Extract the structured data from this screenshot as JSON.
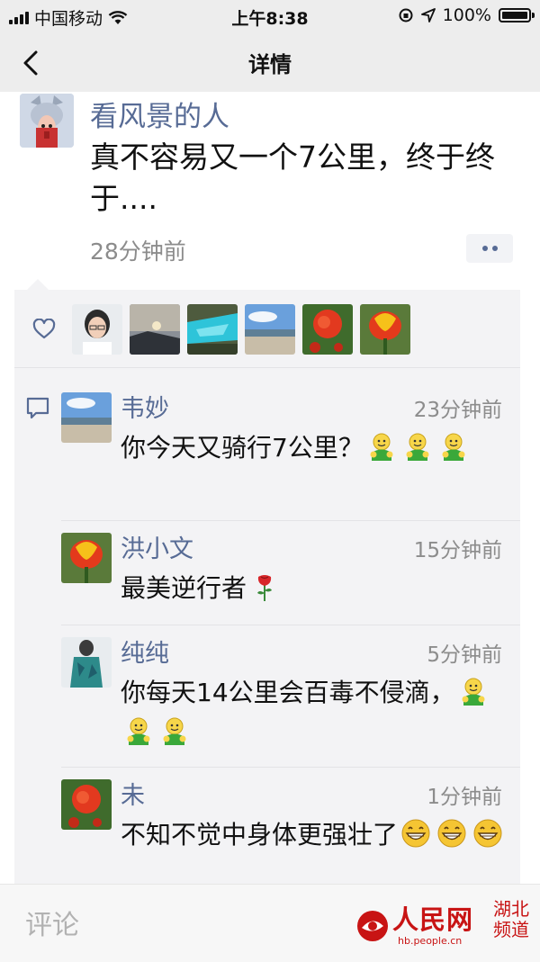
{
  "status_bar": {
    "carrier": "中国移动",
    "time": "上午8:38",
    "battery": "100%",
    "battery_level": 1.0
  },
  "nav": {
    "title": "详情",
    "back_icon": "chevron-left-icon"
  },
  "post": {
    "author": "看风景的人",
    "text": "真不容易又一个7公里，终于终于....",
    "time": "28分钟前",
    "more_icon": "two-dots-icon"
  },
  "likes": {
    "icon": "heart-icon",
    "avatars": [
      "person-photo",
      "sunset-photo",
      "blue-water-photo",
      "beach-photo",
      "red-flower-photo",
      "tulip-photo"
    ]
  },
  "comments": [
    {
      "name": "韦妙",
      "time": "23分钟前",
      "text": "你今天又骑行7公里？",
      "emoji_count": 3,
      "emoji": "green-thumbs-up-emoji",
      "avatar": "beach-photo"
    },
    {
      "name": "洪小文",
      "time": "15分钟前",
      "text": "最美逆行者",
      "emoji_count": 1,
      "emoji": "rose-emoji",
      "avatar": "tulip-photo"
    },
    {
      "name": "纯纯",
      "time": "5分钟前",
      "text": "你每天14公里会百毒不侵滴，",
      "emoji_count": 3,
      "emoji": "green-thumbs-up-emoji",
      "avatar": "green-dress-photo"
    },
    {
      "name": "未",
      "time": "1分钟前",
      "text": "不知不觉中身体更强壮了",
      "emoji_count": 3,
      "emoji": "grin-emoji",
      "avatar": "red-flower-photo"
    }
  ],
  "bottom_bar": {
    "placeholder": "评论"
  },
  "watermark": {
    "brand": "人民网",
    "region": "湖北频道",
    "url": "hb.people.cn"
  },
  "colors": {
    "link_blue": "#576b95",
    "panel_bg": "#f3f3f5",
    "nav_bg": "#ededed",
    "watermark_red": "#c81414"
  }
}
